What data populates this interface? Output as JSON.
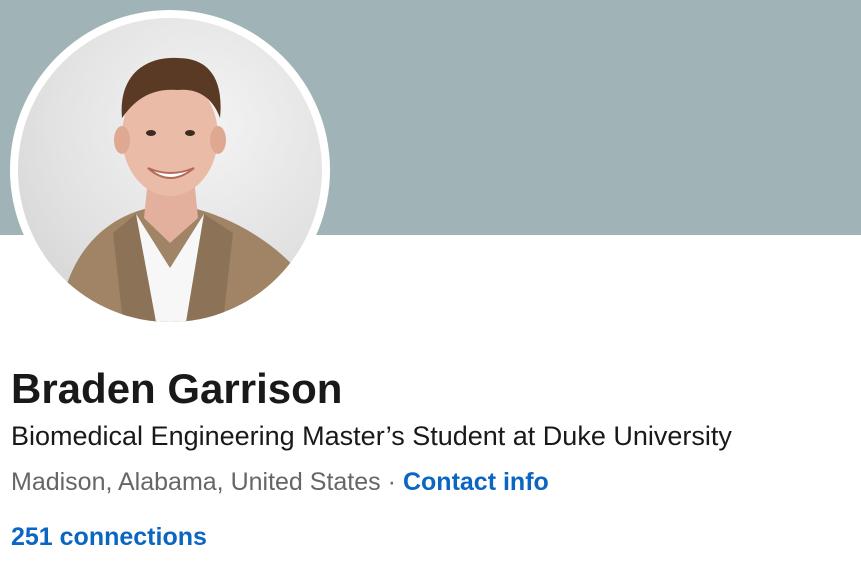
{
  "profile": {
    "name": "Braden Garrison",
    "headline": "Biomedical Engineering Master’s Student at Duke University",
    "location": "Madison, Alabama, United States",
    "separator": "·",
    "contact_label": "Contact info",
    "connections_label": "251 connections"
  },
  "colors": {
    "banner": "#a0b4b7",
    "link": "#0a66c2",
    "primary_text": "#191919",
    "secondary_text": "#666666"
  }
}
